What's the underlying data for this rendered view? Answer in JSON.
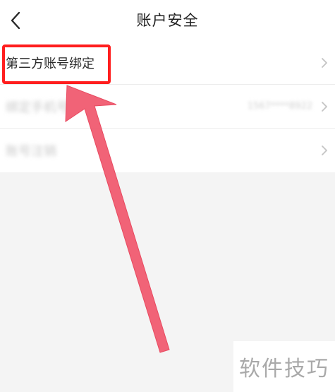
{
  "header": {
    "title": "账户安全",
    "back_icon": "chevron-left-icon"
  },
  "settings": {
    "items": [
      {
        "label": "第三方账号绑定",
        "value": ""
      },
      {
        "label": "绑定手机号",
        "value": "1567****8922"
      },
      {
        "label": "账号注销",
        "value": ""
      }
    ]
  },
  "annotation": {
    "highlight_color": "#ff1e1e",
    "arrow_color": "#f0566b"
  },
  "watermark": {
    "text": "软件技巧"
  }
}
